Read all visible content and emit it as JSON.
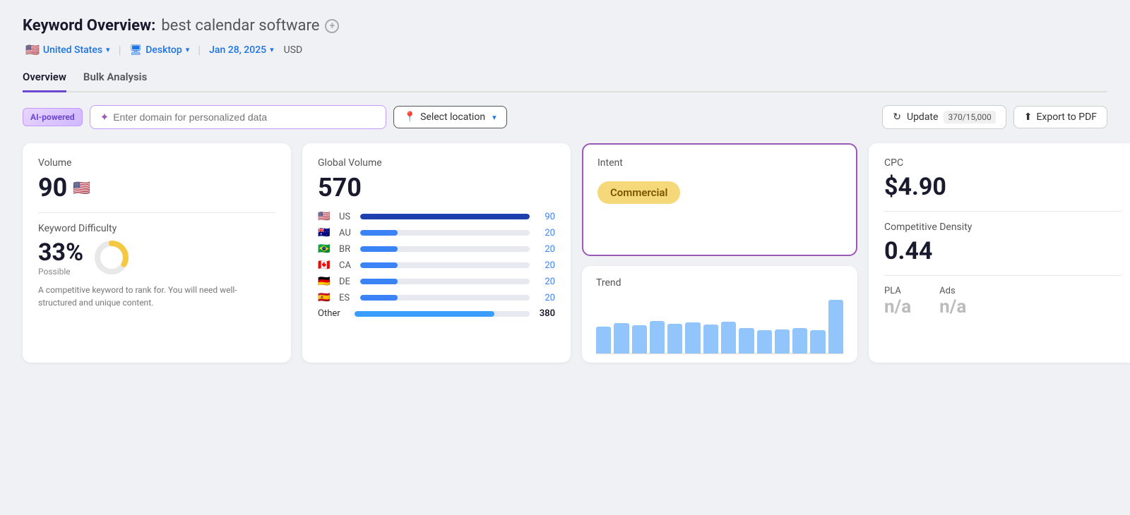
{
  "page": {
    "title_prefix": "Keyword Overview:",
    "keyword": "best calendar software",
    "add_icon": "+",
    "country": "United States",
    "device": "Desktop",
    "date": "Jan 28, 2025",
    "currency": "USD"
  },
  "tabs": [
    {
      "id": "overview",
      "label": "Overview",
      "active": true
    },
    {
      "id": "bulk",
      "label": "Bulk Analysis",
      "active": false
    }
  ],
  "toolbar": {
    "ai_badge": "AI-powered",
    "domain_placeholder": "Enter domain for personalized data",
    "location_label": "Select location",
    "update_label": "Update",
    "update_count": "370/15,000",
    "export_label": "Export to PDF"
  },
  "cards": {
    "volume": {
      "label": "Volume",
      "value": "90",
      "difficulty_label": "Keyword Difficulty",
      "difficulty_value": "33%",
      "difficulty_sub": "Possible",
      "difficulty_desc": "A competitive keyword to rank for. You will need well-structured and unique content.",
      "donut_pct": 33
    },
    "global_volume": {
      "label": "Global Volume",
      "value": "570",
      "countries": [
        {
          "flag": "🇺🇸",
          "code": "US",
          "count": 90,
          "bar_pct": 100,
          "dark": true
        },
        {
          "flag": "🇦🇺",
          "code": "AU",
          "count": 20,
          "bar_pct": 22,
          "dark": false
        },
        {
          "flag": "🇧🇷",
          "code": "BR",
          "count": 20,
          "bar_pct": 22,
          "dark": false
        },
        {
          "flag": "🇨🇦",
          "code": "CA",
          "count": 20,
          "bar_pct": 22,
          "dark": false
        },
        {
          "flag": "🇩🇪",
          "code": "DE",
          "count": 20,
          "bar_pct": 22,
          "dark": false
        },
        {
          "flag": "🇪🇸",
          "code": "ES",
          "count": 20,
          "bar_pct": 22,
          "dark": false
        }
      ],
      "other_label": "Other",
      "other_count": 380,
      "other_bar_pct": 80
    },
    "intent": {
      "label": "Intent",
      "badge": "Commercial"
    },
    "trend": {
      "label": "Trend",
      "bars": [
        40,
        45,
        42,
        48,
        44,
        46,
        43,
        47,
        38,
        35,
        36,
        38,
        35,
        80
      ]
    },
    "cpc": {
      "label": "CPC",
      "value": "$4.90"
    },
    "competitive_density": {
      "label": "Competitive Density",
      "value": "0.44"
    },
    "pla": {
      "label": "PLA",
      "value": "n/a"
    },
    "ads": {
      "label": "Ads",
      "value": "n/a"
    }
  }
}
